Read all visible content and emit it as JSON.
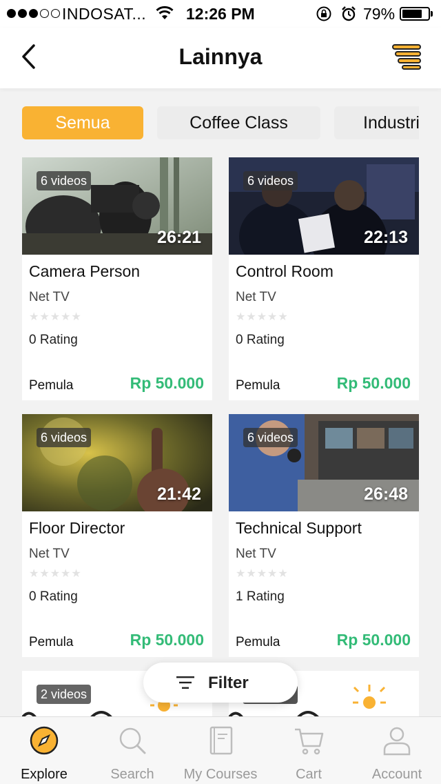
{
  "status_bar": {
    "carrier": "INDOSAT...",
    "time": "12:26 PM",
    "battery": "79%",
    "battery_level": 0.79,
    "signal_bars": 3
  },
  "header": {
    "title": "Lainnya",
    "back_icon": "back-arrow-icon",
    "menu_icon": "list-lines-icon"
  },
  "categories": [
    {
      "label": "Semua",
      "active": true
    },
    {
      "label": "Coffee Class",
      "active": false
    },
    {
      "label": "Industri",
      "active": false
    }
  ],
  "courses": [
    {
      "videos": "6 videos",
      "duration": "26:21",
      "title": "Camera Person",
      "provider": "Net TV",
      "rating_text": "0 Rating",
      "stars": 0,
      "level": "Pemula",
      "price": "Rp 50.000"
    },
    {
      "videos": "6 videos",
      "duration": "22:13",
      "title": "Control Room",
      "provider": "Net TV",
      "rating_text": "0 Rating",
      "stars": 0,
      "level": "Pemula",
      "price": "Rp 50.000"
    },
    {
      "videos": "6 videos",
      "duration": "21:42",
      "title": "Floor Director",
      "provider": "Net TV",
      "rating_text": "0 Rating",
      "stars": 0,
      "level": "Pemula",
      "price": "Rp 50.000"
    },
    {
      "videos": "6 videos",
      "duration": "26:48",
      "title": "Technical Support",
      "provider": "Net TV",
      "rating_text": "1 Rating",
      "stars": 0,
      "level": "Pemula",
      "price": "Rp 50.000"
    },
    {
      "videos": "2 videos"
    }
  ],
  "filter": {
    "label": "Filter",
    "icon": "filter-lines-icon"
  },
  "tabs": [
    {
      "label": "Explore",
      "icon": "compass-icon",
      "active": true
    },
    {
      "label": "Search",
      "icon": "search-icon",
      "active": false
    },
    {
      "label": "My Courses",
      "icon": "book-icon",
      "active": false
    },
    {
      "label": "Cart",
      "icon": "cart-icon",
      "active": false
    },
    {
      "label": "Account",
      "icon": "user-icon",
      "active": false
    }
  ],
  "colors": {
    "accent": "#f9b233",
    "price": "#33bb77",
    "tab_inactive": "#9a9a9a"
  }
}
